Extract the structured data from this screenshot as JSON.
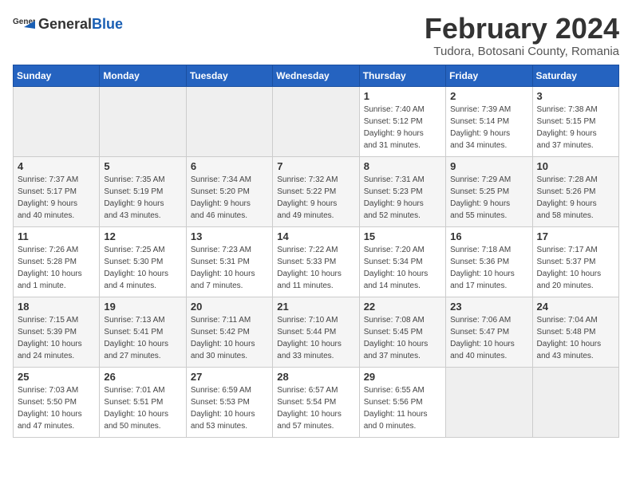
{
  "header": {
    "logo_general": "General",
    "logo_blue": "Blue",
    "title": "February 2024",
    "subtitle": "Tudora, Botosani County, Romania"
  },
  "days_of_week": [
    "Sunday",
    "Monday",
    "Tuesday",
    "Wednesday",
    "Thursday",
    "Friday",
    "Saturday"
  ],
  "weeks": [
    [
      {
        "day": "",
        "info": ""
      },
      {
        "day": "",
        "info": ""
      },
      {
        "day": "",
        "info": ""
      },
      {
        "day": "",
        "info": ""
      },
      {
        "day": "1",
        "info": "Sunrise: 7:40 AM\nSunset: 5:12 PM\nDaylight: 9 hours\nand 31 minutes."
      },
      {
        "day": "2",
        "info": "Sunrise: 7:39 AM\nSunset: 5:14 PM\nDaylight: 9 hours\nand 34 minutes."
      },
      {
        "day": "3",
        "info": "Sunrise: 7:38 AM\nSunset: 5:15 PM\nDaylight: 9 hours\nand 37 minutes."
      }
    ],
    [
      {
        "day": "4",
        "info": "Sunrise: 7:37 AM\nSunset: 5:17 PM\nDaylight: 9 hours\nand 40 minutes."
      },
      {
        "day": "5",
        "info": "Sunrise: 7:35 AM\nSunset: 5:19 PM\nDaylight: 9 hours\nand 43 minutes."
      },
      {
        "day": "6",
        "info": "Sunrise: 7:34 AM\nSunset: 5:20 PM\nDaylight: 9 hours\nand 46 minutes."
      },
      {
        "day": "7",
        "info": "Sunrise: 7:32 AM\nSunset: 5:22 PM\nDaylight: 9 hours\nand 49 minutes."
      },
      {
        "day": "8",
        "info": "Sunrise: 7:31 AM\nSunset: 5:23 PM\nDaylight: 9 hours\nand 52 minutes."
      },
      {
        "day": "9",
        "info": "Sunrise: 7:29 AM\nSunset: 5:25 PM\nDaylight: 9 hours\nand 55 minutes."
      },
      {
        "day": "10",
        "info": "Sunrise: 7:28 AM\nSunset: 5:26 PM\nDaylight: 9 hours\nand 58 minutes."
      }
    ],
    [
      {
        "day": "11",
        "info": "Sunrise: 7:26 AM\nSunset: 5:28 PM\nDaylight: 10 hours\nand 1 minute."
      },
      {
        "day": "12",
        "info": "Sunrise: 7:25 AM\nSunset: 5:30 PM\nDaylight: 10 hours\nand 4 minutes."
      },
      {
        "day": "13",
        "info": "Sunrise: 7:23 AM\nSunset: 5:31 PM\nDaylight: 10 hours\nand 7 minutes."
      },
      {
        "day": "14",
        "info": "Sunrise: 7:22 AM\nSunset: 5:33 PM\nDaylight: 10 hours\nand 11 minutes."
      },
      {
        "day": "15",
        "info": "Sunrise: 7:20 AM\nSunset: 5:34 PM\nDaylight: 10 hours\nand 14 minutes."
      },
      {
        "day": "16",
        "info": "Sunrise: 7:18 AM\nSunset: 5:36 PM\nDaylight: 10 hours\nand 17 minutes."
      },
      {
        "day": "17",
        "info": "Sunrise: 7:17 AM\nSunset: 5:37 PM\nDaylight: 10 hours\nand 20 minutes."
      }
    ],
    [
      {
        "day": "18",
        "info": "Sunrise: 7:15 AM\nSunset: 5:39 PM\nDaylight: 10 hours\nand 24 minutes."
      },
      {
        "day": "19",
        "info": "Sunrise: 7:13 AM\nSunset: 5:41 PM\nDaylight: 10 hours\nand 27 minutes."
      },
      {
        "day": "20",
        "info": "Sunrise: 7:11 AM\nSunset: 5:42 PM\nDaylight: 10 hours\nand 30 minutes."
      },
      {
        "day": "21",
        "info": "Sunrise: 7:10 AM\nSunset: 5:44 PM\nDaylight: 10 hours\nand 33 minutes."
      },
      {
        "day": "22",
        "info": "Sunrise: 7:08 AM\nSunset: 5:45 PM\nDaylight: 10 hours\nand 37 minutes."
      },
      {
        "day": "23",
        "info": "Sunrise: 7:06 AM\nSunset: 5:47 PM\nDaylight: 10 hours\nand 40 minutes."
      },
      {
        "day": "24",
        "info": "Sunrise: 7:04 AM\nSunset: 5:48 PM\nDaylight: 10 hours\nand 43 minutes."
      }
    ],
    [
      {
        "day": "25",
        "info": "Sunrise: 7:03 AM\nSunset: 5:50 PM\nDaylight: 10 hours\nand 47 minutes."
      },
      {
        "day": "26",
        "info": "Sunrise: 7:01 AM\nSunset: 5:51 PM\nDaylight: 10 hours\nand 50 minutes."
      },
      {
        "day": "27",
        "info": "Sunrise: 6:59 AM\nSunset: 5:53 PM\nDaylight: 10 hours\nand 53 minutes."
      },
      {
        "day": "28",
        "info": "Sunrise: 6:57 AM\nSunset: 5:54 PM\nDaylight: 10 hours\nand 57 minutes."
      },
      {
        "day": "29",
        "info": "Sunrise: 6:55 AM\nSunset: 5:56 PM\nDaylight: 11 hours\nand 0 minutes."
      },
      {
        "day": "",
        "info": ""
      },
      {
        "day": "",
        "info": ""
      }
    ]
  ]
}
